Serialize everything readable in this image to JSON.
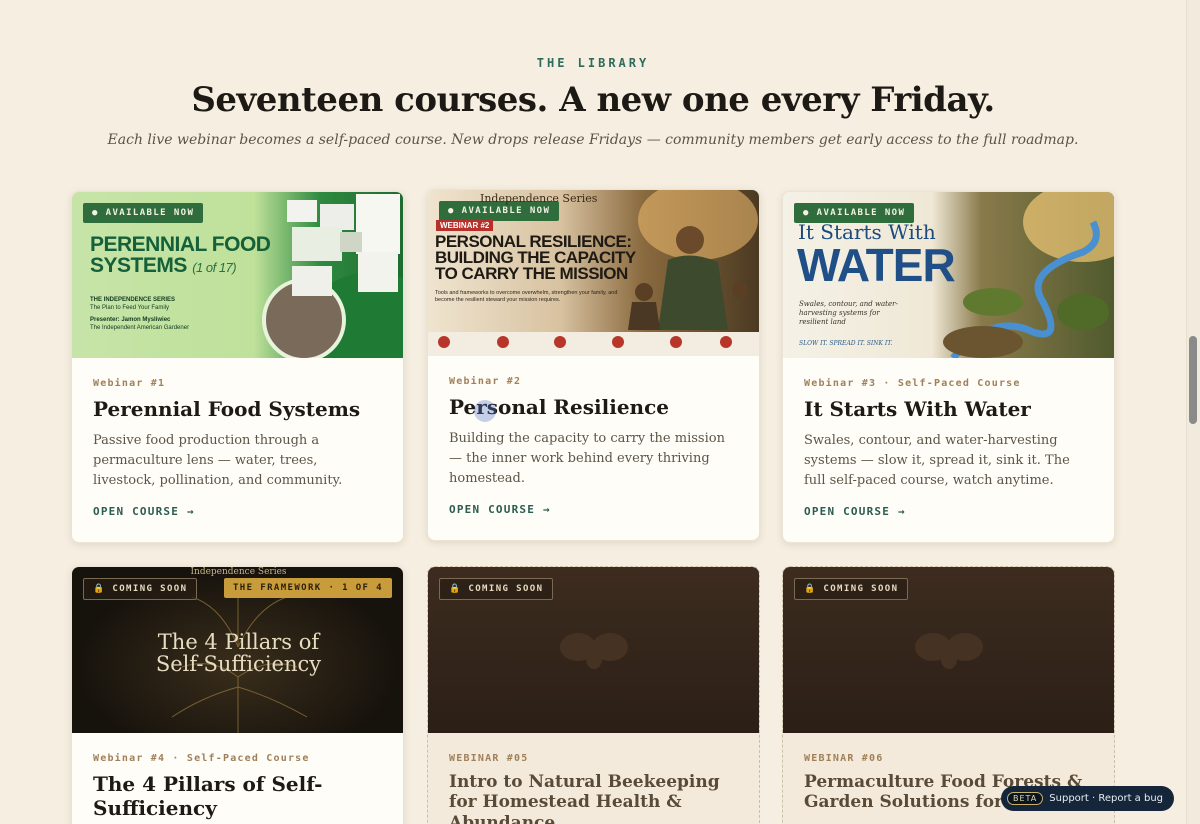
{
  "header": {
    "eyebrow": "THE LIBRARY",
    "title": "Seventeen courses. A new one every Friday.",
    "subtitle": "Each live webinar becomes a self-paced course. New drops release Fridays — community members get early access to the full roadmap."
  },
  "courses": [
    {
      "badge": "● AVAILABLE NOW",
      "meta": "Webinar #1",
      "title": "Perennial Food Systems",
      "description": "Passive food production through a permaculture lens — water, trees, livestock, pollination, and community.",
      "link": "OPEN COURSE →",
      "thumb": {
        "headline_1": "PERENNIAL FOOD",
        "headline_2": "SYSTEMS",
        "counter": "(1 of 17)",
        "series": "THE INDEPENDENCE SERIES",
        "tagline": "The Plan to Feed Your Family",
        "presenter_line": "Presenter: Jamon Mysliwiec",
        "presenter_org": "The Independent American Gardener"
      }
    },
    {
      "badge": "● AVAILABLE NOW",
      "meta": "Webinar #2",
      "title": "Personal Resilience",
      "description": "Building the capacity to carry the mission — the inner work behind every thriving homestead.",
      "link": "OPEN COURSE →",
      "thumb": {
        "series": "Independence Series",
        "tag": "WEBINAR #2",
        "headline_1": "PERSONAL RESILIENCE:",
        "headline_2": "BUILDING THE CAPACITY",
        "headline_3": "TO CARRY THE MISSION",
        "blurb": "Tools and frameworks to overcome overwhelm, strengthen your family, and become the resilient steward your mission requires."
      }
    },
    {
      "badge": "● AVAILABLE NOW",
      "meta": "Webinar #3 · Self-Paced Course",
      "title": "It Starts With Water",
      "description": "Swales, contour, and water-harvesting systems — slow it, spread it, sink it. The full self-paced course, watch anytime.",
      "link": "OPEN COURSE →",
      "thumb": {
        "headline_1": "It Starts With",
        "headline_2": "WATER",
        "blurb": "Swales, contour, and water-harvesting systems for resilient land",
        "slogan": "SLOW IT. SPREAD IT. SINK IT."
      }
    },
    {
      "badge": "🔒 COMING SOON",
      "badge2": "THE FRAMEWORK · 1 OF 4",
      "meta": "Webinar #4 · Self-Paced Course",
      "title": "The 4 Pillars of Self-Sufficiency",
      "thumb": {
        "series": "Independence Series",
        "headline_1": "The 4 Pillars of",
        "headline_2": "Self-Sufficiency"
      }
    },
    {
      "badge": "🔒 COMING SOON",
      "meta": "WEBINAR #05",
      "title": "Intro to Natural Beekeeping for Homestead Health & Abundance"
    },
    {
      "badge": "🔒 COMING SOON",
      "meta": "WEBINAR #06",
      "title": "Permaculture Food Forests & Garden Solutions for Food"
    }
  ],
  "support": {
    "beta": "BETA",
    "label": "Support · Report a bug"
  },
  "colors": {
    "page_bg": "#f6efe1",
    "accent_green": "#2f6e3c",
    "teal_link": "#2b5c52",
    "meta_brown": "#a0805a"
  }
}
